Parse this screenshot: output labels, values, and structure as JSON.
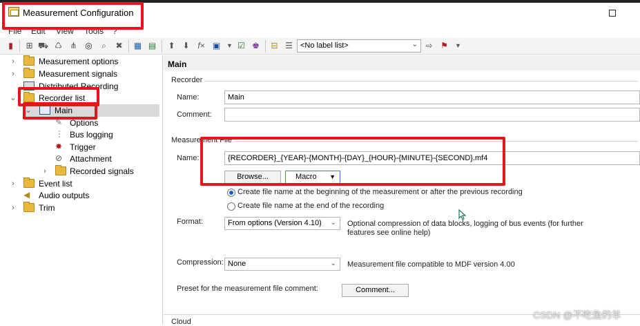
{
  "window": {
    "title": "Measurement Configuration"
  },
  "menu": [
    "File",
    "Edit",
    "View",
    "Tools",
    "?"
  ],
  "toolbar": {
    "label_list": "<No label list>"
  },
  "tree": {
    "items": [
      {
        "label": "Measurement options"
      },
      {
        "label": "Measurement signals"
      },
      {
        "label": "Distributed Recording"
      },
      {
        "label": "Recorder list"
      },
      {
        "label": "Main"
      },
      {
        "label": "Options"
      },
      {
        "label": "Bus logging"
      },
      {
        "label": "Trigger"
      },
      {
        "label": "Attachment"
      },
      {
        "label": "Recorded signals"
      },
      {
        "label": "Event list"
      },
      {
        "label": "Audio outputs"
      },
      {
        "label": "Trim"
      }
    ]
  },
  "panel": {
    "title": "Main",
    "recorder_group": "Recorder",
    "name_label": "Name:",
    "name_value": "Main",
    "comment_label": "Comment:",
    "comment_value": "",
    "file_group": "Measurement File",
    "file_name_label": "Name:",
    "file_name_value": "{RECORDER}_{YEAR}-{MONTH}-{DAY}_{HOUR}-{MINUTE}-{SECOND}.mf4",
    "browse_label": "Browse...",
    "macro_label": "Macro",
    "radio1": "Create file name at the beginning of the measurement or after the previous recording",
    "radio2": "Create file name at the end of the recording",
    "format_label": "Format:",
    "format_value": "From options (Version 4.10)",
    "format_desc_1": "Optional compression of data blocks, logging of bus events (for further",
    "format_desc_2": "features see online help)",
    "compression_label": "Compression:",
    "compression_value": "None",
    "compression_desc": "Measurement file compatible to MDF version 4.00",
    "preset_label": "Preset for the measurement file comment:",
    "comment_button": "Comment...",
    "cloud_group": "Cloud"
  },
  "watermark": "CSDN @不吃鱼的羊",
  "colors": {
    "annotation": "#e8131b",
    "selection": "#d9d9d9",
    "radio_checked": "#1a5fd6"
  }
}
